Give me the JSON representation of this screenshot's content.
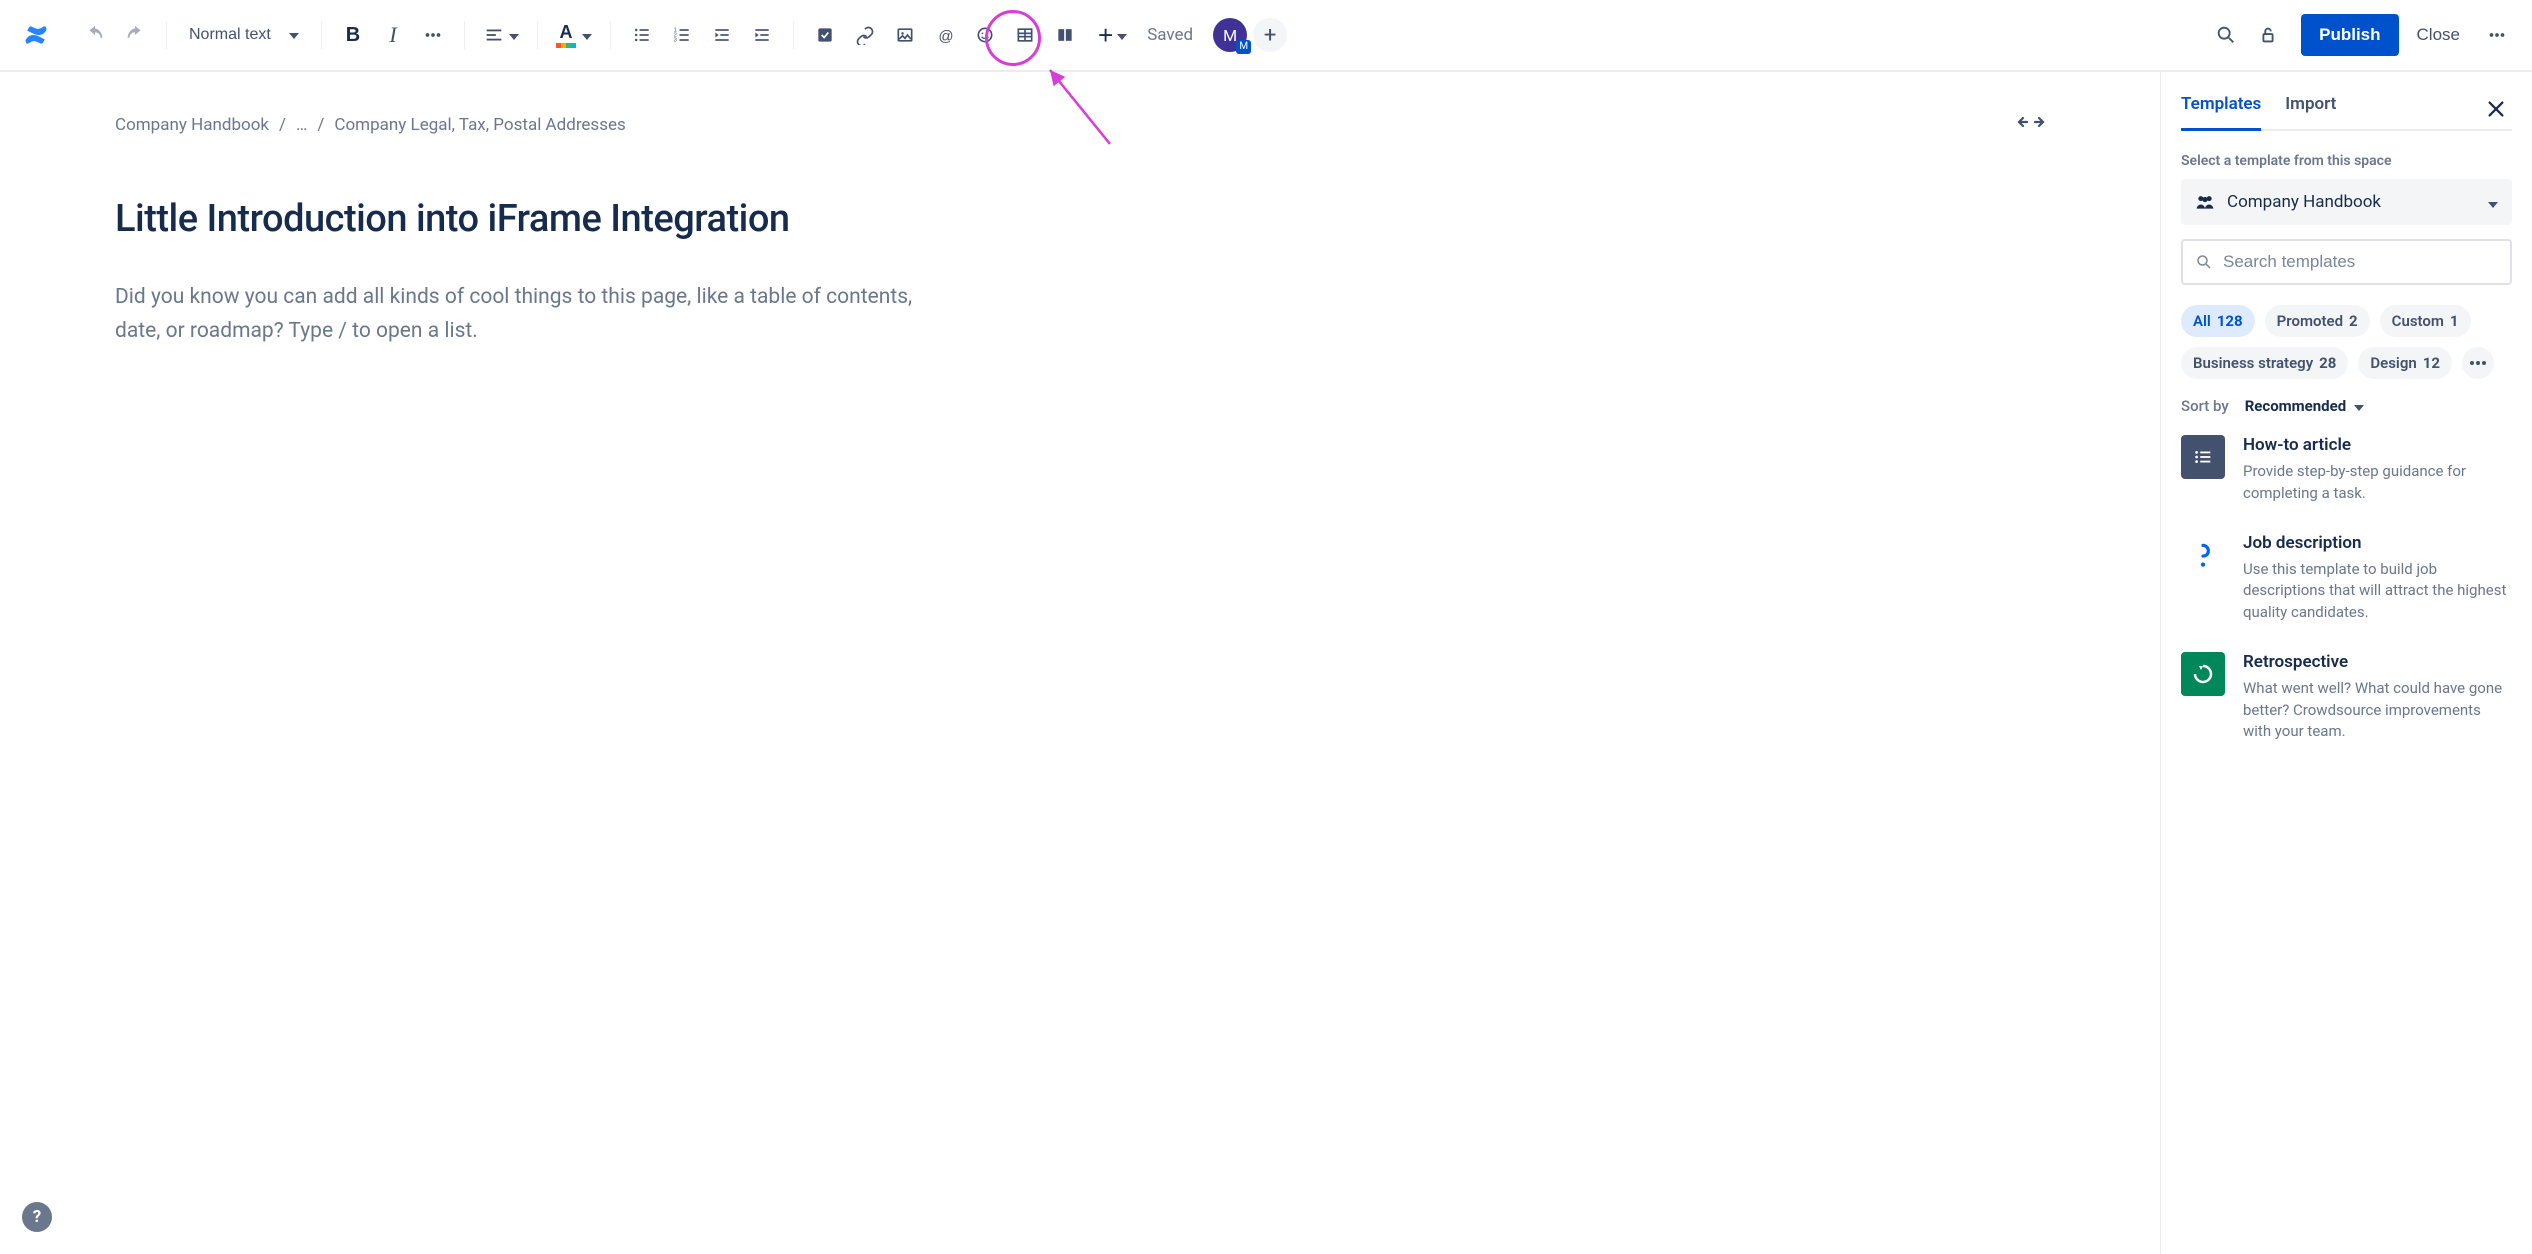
{
  "toolbar": {
    "text_style": "Normal text",
    "saved_label": "Saved",
    "publish_label": "Publish",
    "close_label": "Close",
    "avatar_initial": "M",
    "avatar_badge": "M"
  },
  "breadcrumb": {
    "root": "Company Handbook",
    "ellipsis": "…",
    "current": "Company Legal, Tax, Postal Addresses"
  },
  "page": {
    "title": "Little Introduction into iFrame Integration",
    "placeholder": "Did you know you can add all kinds of cool things to this page, like a table of contents, date, or roadmap? Type / to open a list."
  },
  "panel": {
    "tabs": {
      "templates": "Templates",
      "import": "Import"
    },
    "help": "Select a template from this space",
    "space_name": "Company Handbook",
    "search_placeholder": "Search templates",
    "chips": [
      {
        "label": "All",
        "count": "128",
        "active": true
      },
      {
        "label": "Promoted",
        "count": "2"
      },
      {
        "label": "Custom",
        "count": "1"
      },
      {
        "label": "Business strategy",
        "count": "28"
      },
      {
        "label": "Design",
        "count": "12"
      }
    ],
    "sort_label": "Sort by",
    "sort_value": "Recommended",
    "templates": [
      {
        "title": "How-to article",
        "desc": "Provide step-by-step guidance for completing a task.",
        "icon": "gray"
      },
      {
        "title": "Job description",
        "desc": "Use this template to build job descriptions that will attract the highest quality candidates.",
        "icon": "white"
      },
      {
        "title": "Retrospective",
        "desc": "What went well? What could have gone better? Crowdsource improvements with your team.",
        "icon": "green"
      }
    ]
  },
  "help_bubble": "?"
}
